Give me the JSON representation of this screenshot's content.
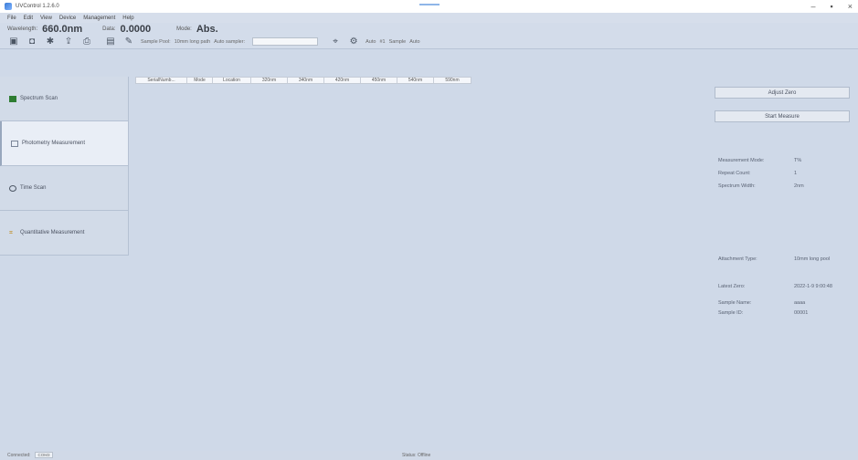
{
  "window": {
    "title": "UVControl 1.2.6.0",
    "minimize": "–",
    "maximize": "▪",
    "close": "×"
  },
  "menu": [
    "File",
    "Edit",
    "View",
    "Device",
    "Management",
    "Help"
  ],
  "readouts": {
    "wavelength_label": "Wavelength:",
    "wavelength_value": "660.0nm",
    "data_label": "Data:",
    "data_value": "0.0000",
    "mode_label": "Mode:",
    "mode_value": "Abs."
  },
  "toolbar": {
    "sample_pool_label": "Sample Pool:",
    "sample_pool_value": "10mm long path",
    "auto_sampler_label": "Auto sampler:",
    "extra_labels": [
      "Auto",
      "#1",
      "Sample",
      "Auto"
    ]
  },
  "sidebar": {
    "items": [
      {
        "label": "Spectrum Scan"
      },
      {
        "label": "Photometry Measurement"
      },
      {
        "label": "Time Scan"
      },
      {
        "label": "Quantitative Measurement"
      }
    ]
  },
  "grid": {
    "columns": [
      "SerialNumb...",
      "Mode",
      "Location",
      "320nm",
      "340nm",
      "420nm",
      "450nm",
      "540nm",
      "590nm"
    ]
  },
  "right_panel": {
    "adjust_zero": "Adjust Zero",
    "start_measure": "Start Measure",
    "measurement_mode_label": "Measurement Mode:",
    "measurement_mode_value": "T%",
    "repeat_count_label": "Repeat Count:",
    "repeat_count_value": "1",
    "spectrum_width_label": "Spectrum Width:",
    "spectrum_width_value": "2nm",
    "attachment_type_label": "Attachment Type:",
    "attachment_type_value": "10mm long pool",
    "latest_zero_label": "Latest Zero:",
    "latest_zero_value": "2022-1-9 9:00:48",
    "sample_name_label": "Sample Name:",
    "sample_name_value": "aaaa",
    "sample_id_label": "Sample ID:",
    "sample_id_value": "00001"
  },
  "statusbar": {
    "connect_label": "Connected:",
    "connect_value": "COM3",
    "status_text": "Status: Offline"
  }
}
